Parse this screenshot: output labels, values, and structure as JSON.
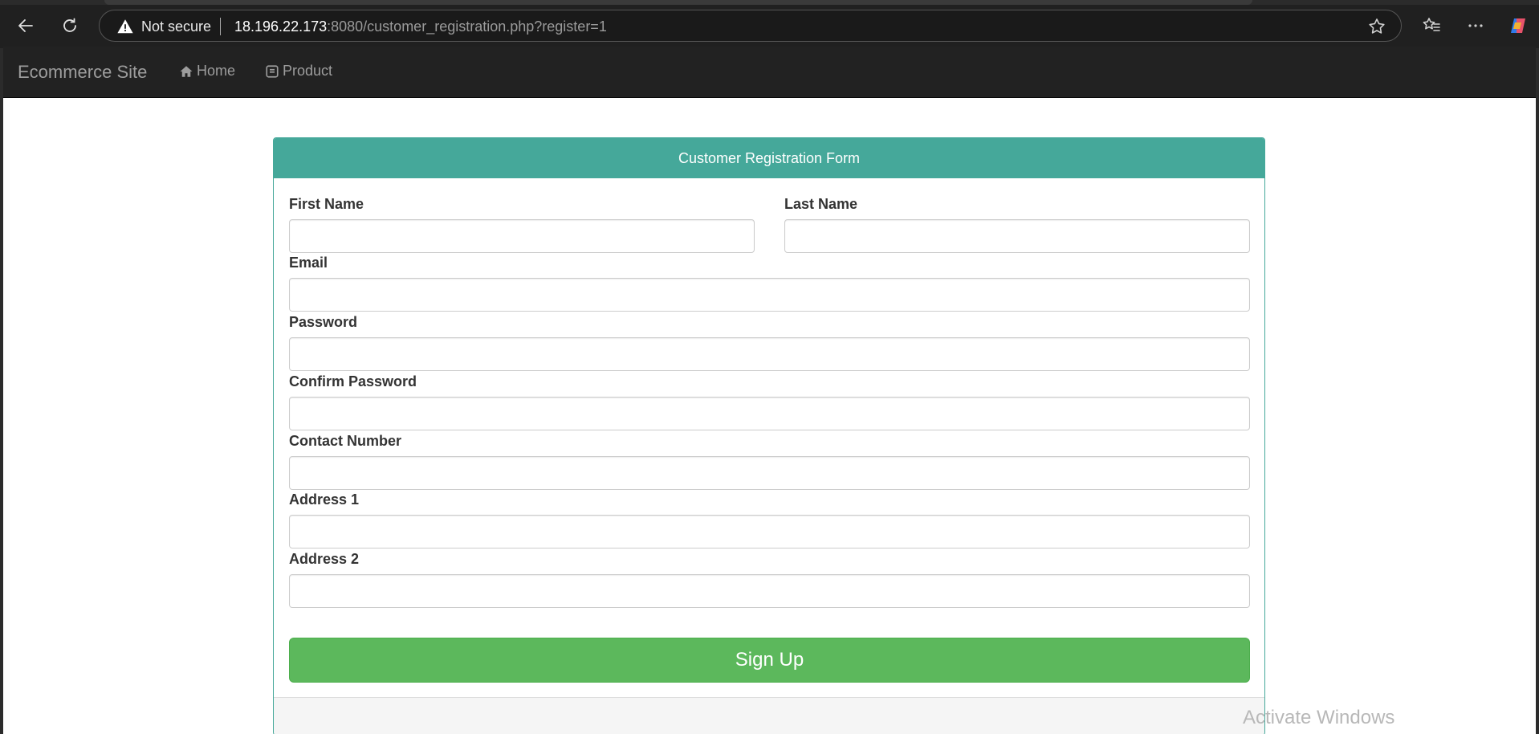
{
  "browser": {
    "security_label": "Not secure",
    "url_host": "18.196.22.173",
    "url_rest": ":8080/customer_registration.php?register=1",
    "icons": [
      "back-arrow-icon",
      "refresh-icon",
      "warning-icon",
      "star-icon",
      "favorites-icon",
      "more-icon",
      "copilot-icon"
    ]
  },
  "navbar": {
    "brand": "Ecommerce Site",
    "links": [
      {
        "label": "Home",
        "icon": "home-icon"
      },
      {
        "label": "Product",
        "icon": "product-icon"
      }
    ]
  },
  "form": {
    "title": "Customer Registration Form",
    "fields": {
      "first_name": {
        "label": "First Name",
        "value": ""
      },
      "last_name": {
        "label": "Last Name",
        "value": ""
      },
      "email": {
        "label": "Email",
        "value": ""
      },
      "password": {
        "label": "Password",
        "value": ""
      },
      "confirm_password": {
        "label": "Confirm Password",
        "value": ""
      },
      "contact_number": {
        "label": "Contact Number",
        "value": ""
      },
      "address1": {
        "label": "Address 1",
        "value": ""
      },
      "address2": {
        "label": "Address 2",
        "value": ""
      }
    },
    "submit_label": "Sign Up"
  },
  "watermark": "Activate Windows",
  "colors": {
    "panel_accent": "#45a89a",
    "signup_button": "#5cb85c",
    "navbar_bg": "#222222"
  }
}
